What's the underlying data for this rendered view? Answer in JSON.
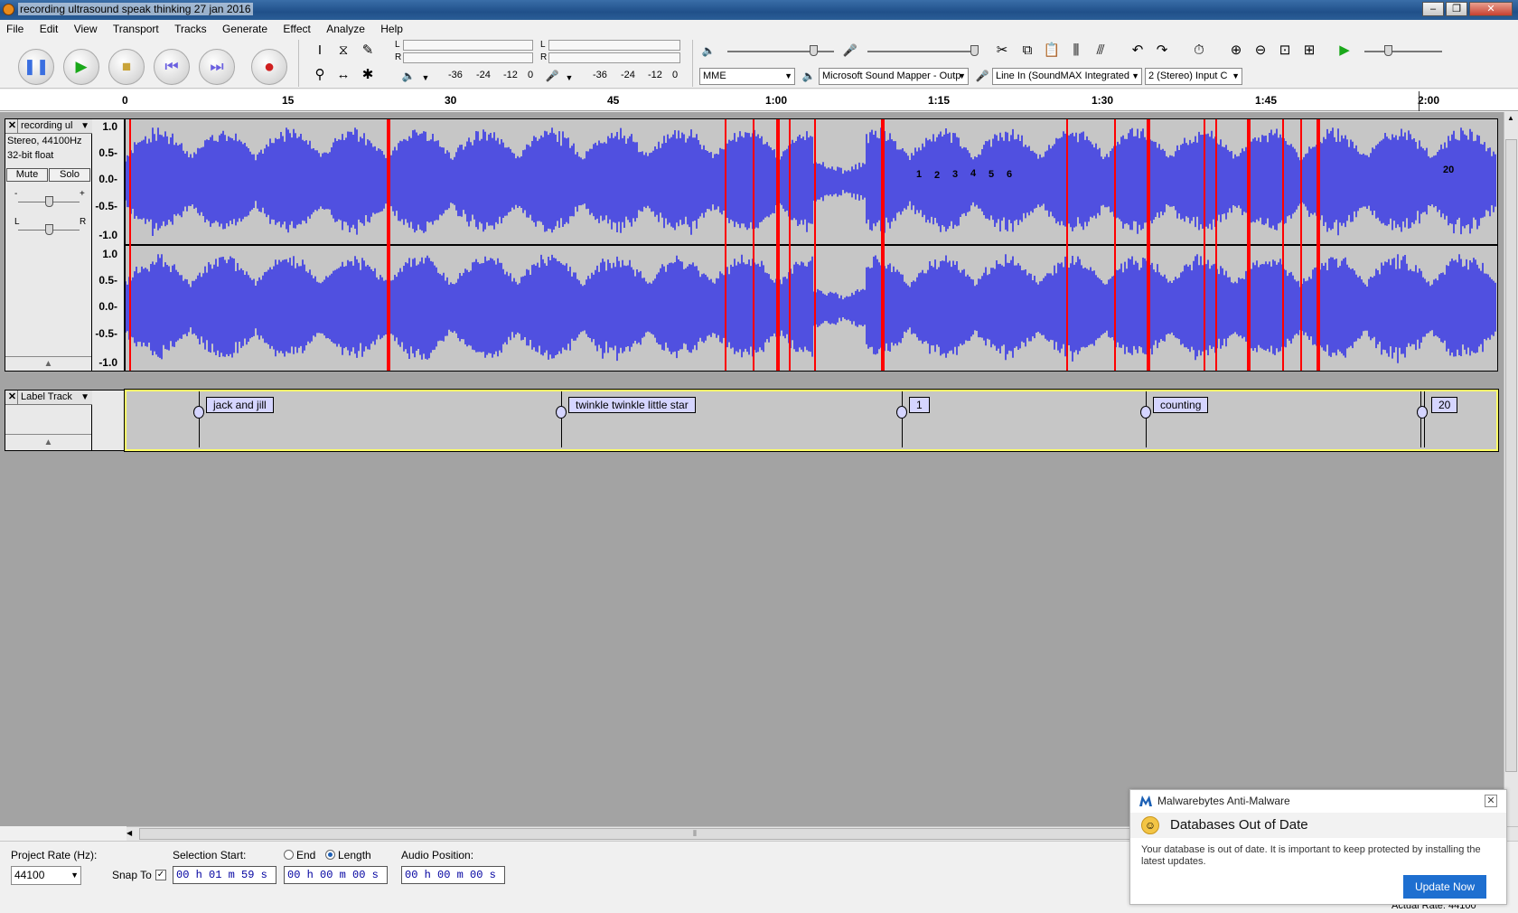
{
  "window": {
    "title": "recording ultrasound speak thinking 27 jan 2016"
  },
  "menu": [
    "File",
    "Edit",
    "View",
    "Transport",
    "Tracks",
    "Generate",
    "Effect",
    "Analyze",
    "Help"
  ],
  "meters": {
    "play_l": "L",
    "play_r": "R",
    "rec_l": "L",
    "rec_r": "R",
    "scale_left": [
      "-36",
      "-24",
      "-12",
      "0"
    ],
    "scale_right": [
      "-36",
      "-24",
      "-12",
      "0"
    ]
  },
  "devices": {
    "host": "MME",
    "output": "Microsoft Sound Mapper - Outp",
    "input": "Line In (SoundMAX Integrated",
    "channels": "2 (Stereo) Input C"
  },
  "ruler": [
    "0",
    "15",
    "30",
    "45",
    "1:00",
    "1:15",
    "1:30",
    "1:45",
    "2:00"
  ],
  "audio_track": {
    "name": "recording ul",
    "format": "Stereo, 44100Hz",
    "bitdepth": "32-bit float",
    "mute": "Mute",
    "solo": "Solo",
    "gain_minus": "-",
    "gain_plus": "+",
    "pan_l": "L",
    "pan_r": "R",
    "scale": [
      "1.0",
      "0.5-",
      "0.0-",
      "-0.5-",
      "-1.0"
    ],
    "markers": [
      "1",
      "2",
      "3",
      "4",
      "5",
      "6",
      "20"
    ]
  },
  "label_track": {
    "name": "Label Track",
    "labels": [
      "jack and jill",
      "twinkle twinkle little star",
      "1",
      "counting",
      "20"
    ]
  },
  "selection_bar": {
    "project_rate_label": "Project Rate (Hz):",
    "project_rate": "44100",
    "snap_to": "Snap To",
    "selection_start_label": "Selection Start:",
    "end_label": "End",
    "length_label": "Length",
    "audio_position_label": "Audio Position:",
    "selection_start": "00 h 01 m 59 s",
    "selection_length": "00 h 00 m 00 s",
    "audio_position": "00 h 00 m 00 s",
    "status": "Actual Rate: 44100"
  },
  "popup": {
    "app": "Malwarebytes Anti-Malware",
    "title": "Databases Out of Date",
    "body": "Your database is out of date. It is important to keep protected by installing the latest updates.",
    "button": "Update Now"
  },
  "colors": {
    "waveform": "#5050e0",
    "clip": "#ff0000",
    "label_bg": "#d5d5ff",
    "focus": "#ffff66"
  }
}
